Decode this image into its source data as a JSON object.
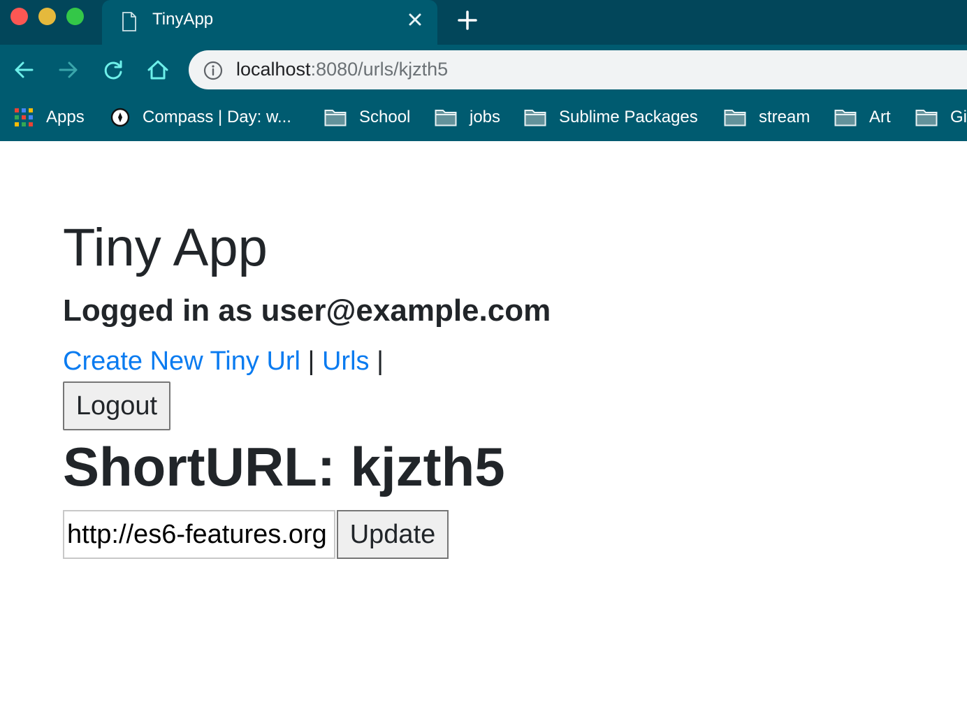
{
  "browser": {
    "tab_title": "TinyApp",
    "url_host": "localhost",
    "url_rest": ":8080/urls/kjzth5",
    "bookmarks": [
      {
        "label": "Apps",
        "icon": "apps-grid-icon"
      },
      {
        "label": "Compass | Day: w...",
        "icon": "compass-icon"
      },
      {
        "label": "School",
        "icon": "folder-icon"
      },
      {
        "label": "jobs",
        "icon": "folder-icon"
      },
      {
        "label": "Sublime Packages",
        "icon": "folder-icon"
      },
      {
        "label": "stream",
        "icon": "folder-icon"
      },
      {
        "label": "Art",
        "icon": "folder-icon"
      },
      {
        "label": "Gi",
        "icon": "folder-icon"
      }
    ],
    "colors": {
      "tab_strip": "#02465a",
      "toolbar": "#005b70",
      "icon_accent": "#6ef0ea"
    }
  },
  "page": {
    "title": "Tiny App",
    "logged_in": "Logged in as user@example.com",
    "nav": {
      "create_link": "Create New Tiny Url",
      "separator": "|",
      "urls_link": "Urls"
    },
    "logout_label": "Logout",
    "short_url_heading": "ShortURL: kjzth5",
    "long_url_value": "http://es6-features.org",
    "update_label": "Update",
    "colors": {
      "link": "#0a7bf0",
      "text": "#212529"
    }
  }
}
